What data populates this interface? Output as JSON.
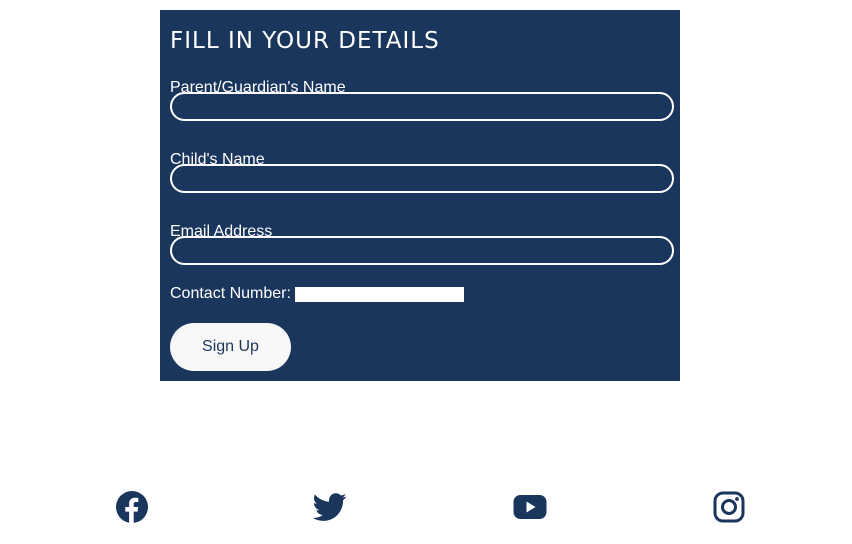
{
  "colors": {
    "panel_background": "#1b365d",
    "text_on_panel": "#ffffff",
    "button_background": "#f7f7f7",
    "icon_color": "#1b365d"
  },
  "form": {
    "title": "FILL IN YOUR DETAILS",
    "fields": [
      {
        "label": "Parent/Guardian's Name",
        "value": ""
      },
      {
        "label": "Child's Name",
        "value": ""
      },
      {
        "label": "Email Address",
        "value": ""
      }
    ],
    "contact": {
      "label": "Contact Number:",
      "value": ""
    },
    "submit_label": "Sign Up"
  },
  "social": [
    {
      "name": "facebook-icon"
    },
    {
      "name": "twitter-icon"
    },
    {
      "name": "youtube-icon"
    },
    {
      "name": "instagram-icon"
    }
  ]
}
